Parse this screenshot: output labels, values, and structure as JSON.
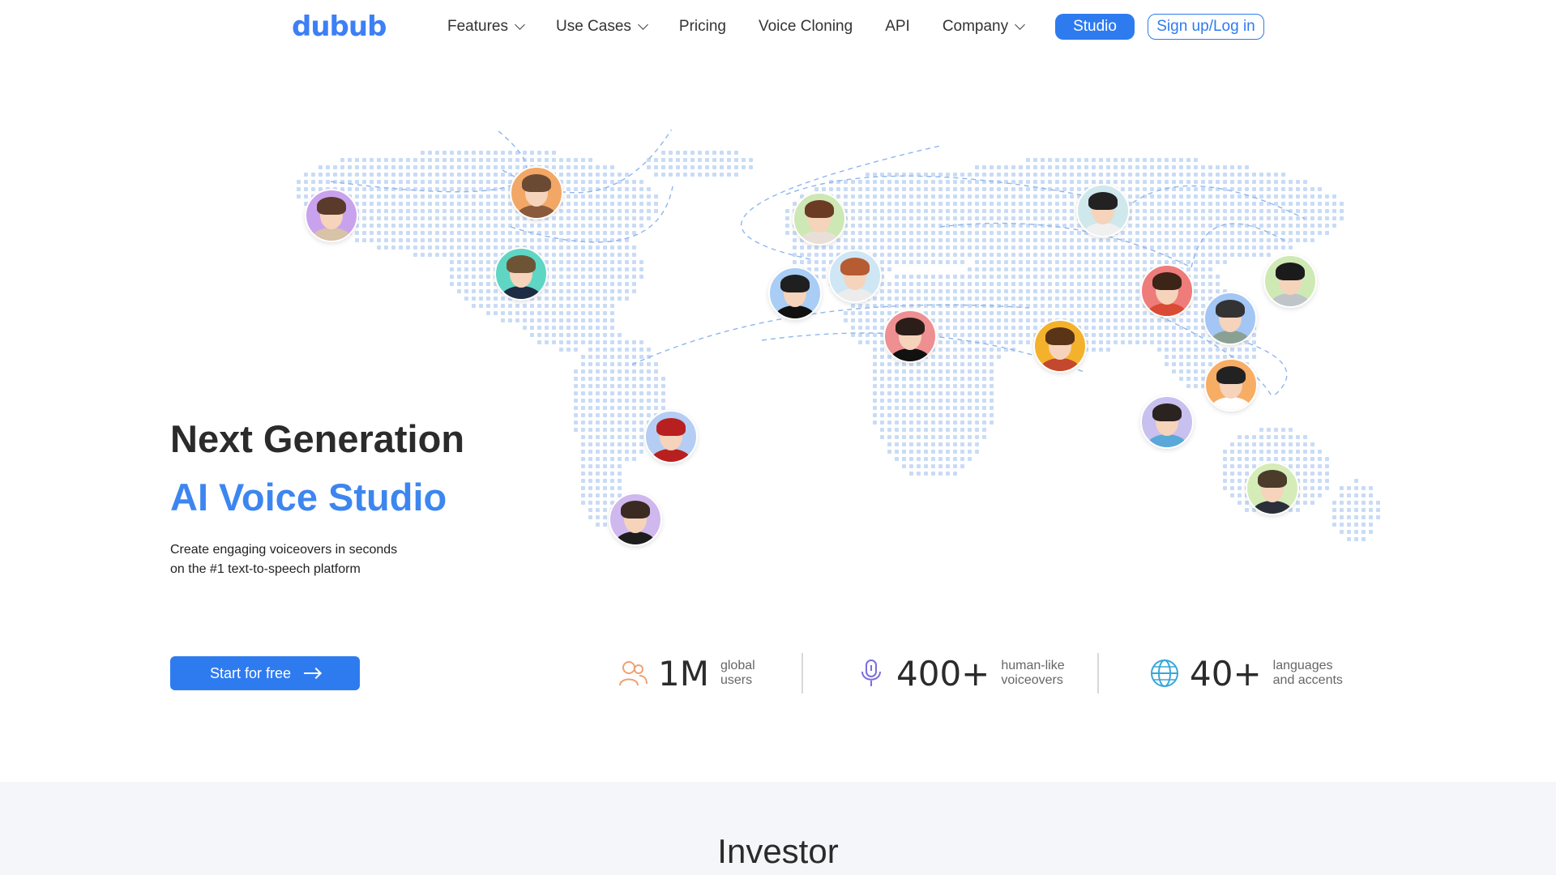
{
  "brand": {
    "logo_text": "dubub"
  },
  "nav": {
    "items": [
      {
        "label": "Features",
        "has_dropdown": true
      },
      {
        "label": "Use Cases",
        "has_dropdown": true
      },
      {
        "label": "Pricing",
        "has_dropdown": false
      },
      {
        "label": "Voice Cloning",
        "has_dropdown": false
      },
      {
        "label": "API",
        "has_dropdown": false
      },
      {
        "label": "Company",
        "has_dropdown": true
      }
    ],
    "studio_label": "Studio",
    "login_label": "Sign up/Log in"
  },
  "hero": {
    "title_line1": "Next Generation",
    "title_line2": "AI Voice Studio",
    "subtitle_line1": "Create engaging voiceovers in seconds",
    "subtitle_line2": "on the #1 text-to-speech platform",
    "cta_label": "Start for free"
  },
  "stats": [
    {
      "icon": "users-icon",
      "value": "1M",
      "label_line1": "global",
      "label_line2": "users",
      "color": "#f0a070"
    },
    {
      "icon": "microphone-icon",
      "value": "400+",
      "label_line1": "human-like",
      "label_line2": "voiceovers",
      "color": "#7a6ee0"
    },
    {
      "icon": "globe-icon",
      "value": "40+",
      "label_line1": "languages",
      "label_line2": "and accents",
      "color": "#3aa6d8"
    }
  ],
  "investor": {
    "title": "Investor"
  },
  "colors": {
    "accent": "#2e7bf0",
    "title_blue": "#3d86f0",
    "map_dots": "#c9dbf5"
  }
}
